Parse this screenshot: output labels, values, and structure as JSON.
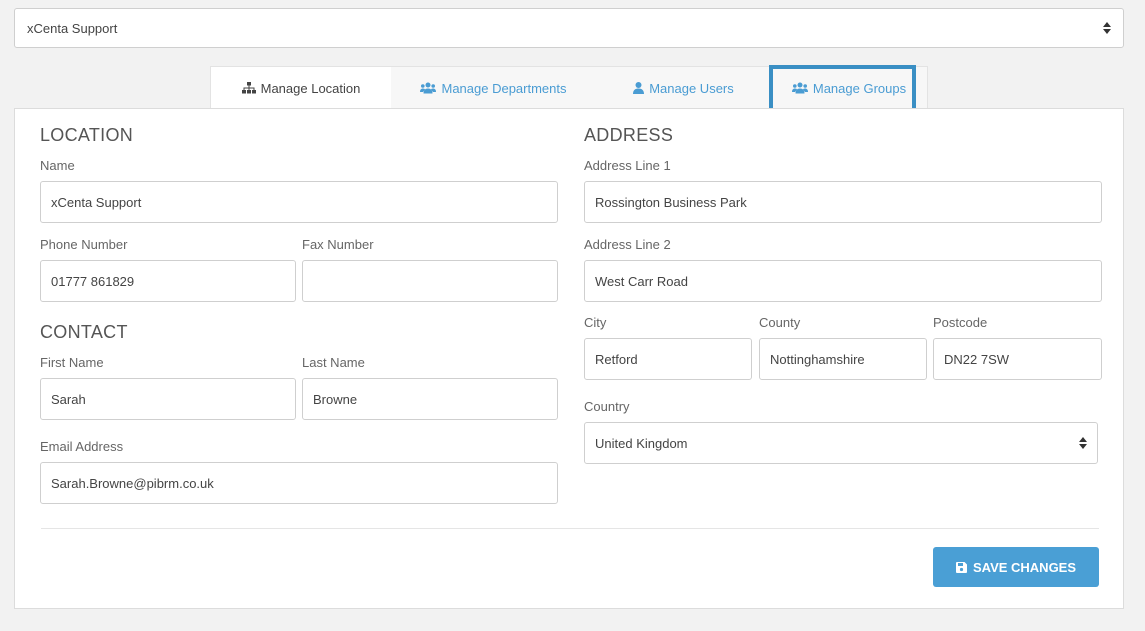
{
  "location_selector": {
    "value": "xCenta Support"
  },
  "tabs": [
    {
      "label": "Manage Location",
      "icon": "sitemap-icon"
    },
    {
      "label": "Manage Departments",
      "icon": "users-icon"
    },
    {
      "label": "Manage Users",
      "icon": "user-icon"
    },
    {
      "label": "Manage Groups",
      "icon": "users-icon"
    }
  ],
  "location": {
    "title": "LOCATION",
    "name_label": "Name",
    "name_value": "xCenta Support",
    "phone_label": "Phone Number",
    "phone_value": "01777 861829",
    "fax_label": "Fax Number",
    "fax_value": ""
  },
  "contact": {
    "title": "CONTACT",
    "first_name_label": "First Name",
    "first_name_value": "Sarah",
    "last_name_label": "Last Name",
    "last_name_value": "Browne",
    "email_label": "Email Address",
    "email_value": "Sarah.Browne@pibrm.co.uk"
  },
  "address": {
    "title": "ADDRESS",
    "line1_label": "Address Line 1",
    "line1_value": "Rossington Business Park",
    "line2_label": "Address Line 2",
    "line2_value": "West Carr Road",
    "city_label": "City",
    "city_value": "Retford",
    "county_label": "County",
    "county_value": "Nottinghamshire",
    "postcode_label": "Postcode",
    "postcode_value": "DN22 7SW",
    "country_label": "Country",
    "country_value": "United Kingdom"
  },
  "actions": {
    "save_label": "SAVE CHANGES"
  },
  "colors": {
    "accent": "#4a9fd5",
    "highlight": "#3a8fc4"
  }
}
